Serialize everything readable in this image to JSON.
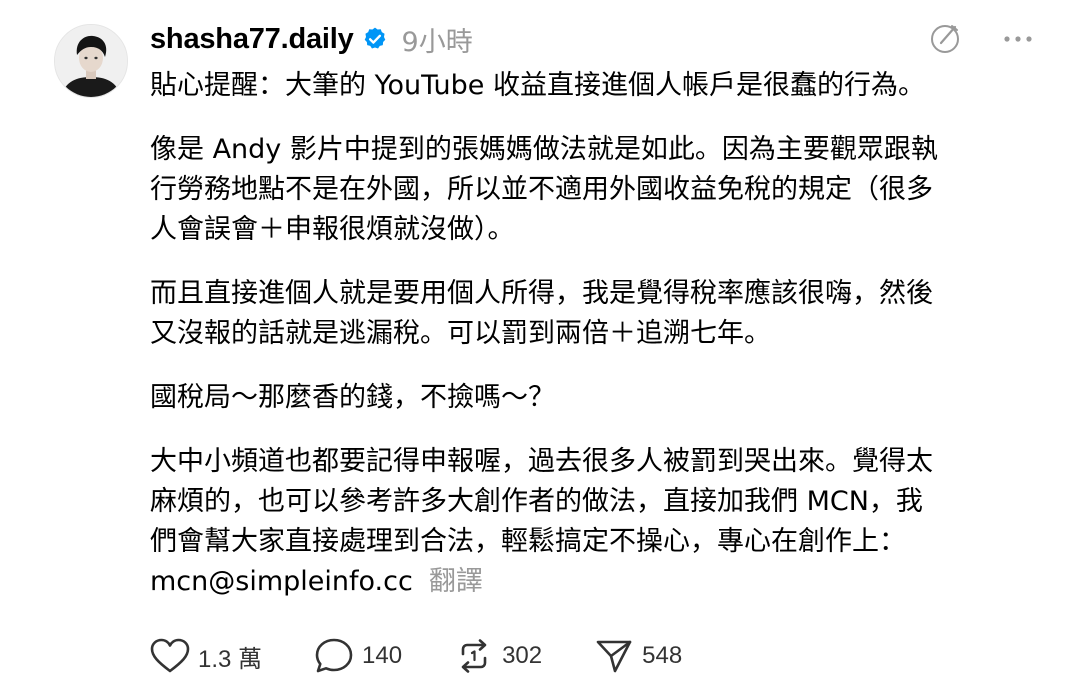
{
  "post": {
    "username": "shasha77.daily",
    "timestamp": "9小時",
    "verified": true,
    "paragraphs": [
      [
        "貼心提醒：大筆的 YouTube 收益直接進個人帳戶是很蠢的行為。"
      ],
      [
        "像是 Andy 影片中提到的張媽媽做法就是如此。因為主要觀眾跟執",
        "行勞務地點不是在外國，所以並不適用外國收益免稅的規定（很多",
        "人會誤會＋申報很煩就沒做）。"
      ],
      [
        "而且直接進個人就是要用個人所得，我是覺得稅率應該很嗨，然後",
        "又沒報的話就是逃漏稅。可以罰到兩倍＋追溯七年。"
      ],
      [
        "國稅局～那麼香的錢，不撿嗎～？"
      ],
      [
        "大中小頻道也都要記得申報喔，過去很多人被罰到哭出來。覺得太",
        "麻煩的，也可以參考許多大創作者的做法，直接加我們 MCN，我",
        "們會幫大家直接處理到合法，輕鬆搞定不操心，專心在創作上：",
        "mcn@simpleinfo.cc"
      ]
    ],
    "translate_label": "翻譯"
  },
  "actions": {
    "likes": "1.3 萬",
    "replies": "140",
    "reposts": "302",
    "shares": "548"
  },
  "icons": {
    "verified": "verified-badge-icon",
    "edit": "edit-icon",
    "more": "more-icon",
    "like": "heart-icon",
    "reply": "comment-icon",
    "repost": "repost-icon",
    "share": "send-icon"
  },
  "colors": {
    "verified_blue": "#0095f6",
    "muted_text": "#999999",
    "text": "#000000"
  }
}
